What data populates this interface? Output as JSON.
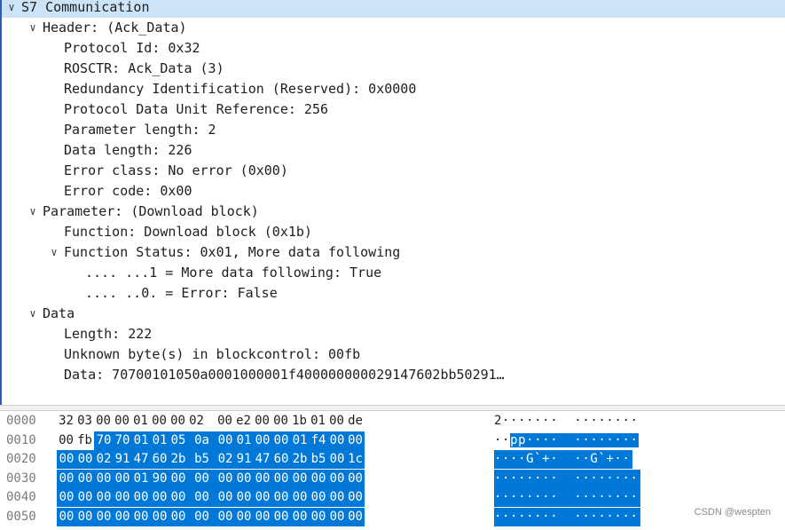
{
  "tree": [
    {
      "level": 0,
      "expanded": true,
      "text": "S7 Communication"
    },
    {
      "level": 1,
      "expanded": true,
      "text": "Header: (Ack_Data)"
    },
    {
      "level": 2,
      "expanded": null,
      "text": "Protocol Id: 0x32"
    },
    {
      "level": 2,
      "expanded": null,
      "text": "ROSCTR: Ack_Data (3)"
    },
    {
      "level": 2,
      "expanded": null,
      "text": "Redundancy Identification (Reserved): 0x0000"
    },
    {
      "level": 2,
      "expanded": null,
      "text": "Protocol Data Unit Reference: 256"
    },
    {
      "level": 2,
      "expanded": null,
      "text": "Parameter length: 2"
    },
    {
      "level": 2,
      "expanded": null,
      "text": "Data length: 226"
    },
    {
      "level": 2,
      "expanded": null,
      "text": "Error class: No error (0x00)"
    },
    {
      "level": 2,
      "expanded": null,
      "text": "Error code: 0x00"
    },
    {
      "level": 1,
      "expanded": true,
      "text": "Parameter: (Download block)"
    },
    {
      "level": 2,
      "expanded": null,
      "text": "Function: Download block (0x1b)"
    },
    {
      "level": 2,
      "expanded": true,
      "text": "Function Status: 0x01, More data following"
    },
    {
      "level": 3,
      "expanded": null,
      "text": ".... ...1 = More data following: True"
    },
    {
      "level": 3,
      "expanded": null,
      "text": ".... ..0. = Error: False"
    },
    {
      "level": 1,
      "expanded": true,
      "text": "Data"
    },
    {
      "level": 2,
      "expanded": null,
      "text": "Length: 222"
    },
    {
      "level": 2,
      "expanded": null,
      "text": "Unknown byte(s) in blockcontrol: 00fb"
    },
    {
      "level": 2,
      "expanded": null,
      "text": "Data: 70700101050a0001000001f400000000029147602bb50291…"
    }
  ],
  "hex": [
    {
      "offset": "0000",
      "bytes": [
        "32",
        "03",
        "00",
        "00",
        "01",
        "00",
        "00",
        "02",
        "00",
        "e2",
        "00",
        "00",
        "1b",
        "01",
        "00",
        "de"
      ],
      "ascii": "2·······  ········",
      "sel_from": 99
    },
    {
      "offset": "0010",
      "bytes": [
        "00",
        "fb",
        "70",
        "70",
        "01",
        "01",
        "05",
        "0a",
        "00",
        "01",
        "00",
        "00",
        "01",
        "f4",
        "00",
        "00"
      ],
      "ascii": "··pp····  ········",
      "sel_from": 2
    },
    {
      "offset": "0020",
      "bytes": [
        "00",
        "00",
        "02",
        "91",
        "47",
        "60",
        "2b",
        "b5",
        "02",
        "91",
        "47",
        "60",
        "2b",
        "b5",
        "00",
        "1c"
      ],
      "ascii": "····G`+·  ··G`+··",
      "sel_from": 0
    },
    {
      "offset": "0030",
      "bytes": [
        "00",
        "00",
        "00",
        "00",
        "01",
        "90",
        "00",
        "00",
        "00",
        "00",
        "00",
        "00",
        "00",
        "00",
        "00",
        "00"
      ],
      "ascii": "········  ········",
      "sel_from": 0
    },
    {
      "offset": "0040",
      "bytes": [
        "00",
        "00",
        "00",
        "00",
        "00",
        "00",
        "00",
        "00",
        "00",
        "00",
        "00",
        "00",
        "00",
        "00",
        "00",
        "00"
      ],
      "ascii": "········  ········",
      "sel_from": 0
    },
    {
      "offset": "0050",
      "bytes": [
        "00",
        "00",
        "00",
        "00",
        "00",
        "00",
        "00",
        "00",
        "00",
        "00",
        "00",
        "00",
        "00",
        "00",
        "00",
        "00"
      ],
      "ascii": "········  ········",
      "sel_from": 0
    }
  ],
  "watermark": "CSDN @wespten",
  "colors": {
    "selection": "#0078d7",
    "tree_highlight": "#cce4f7"
  }
}
